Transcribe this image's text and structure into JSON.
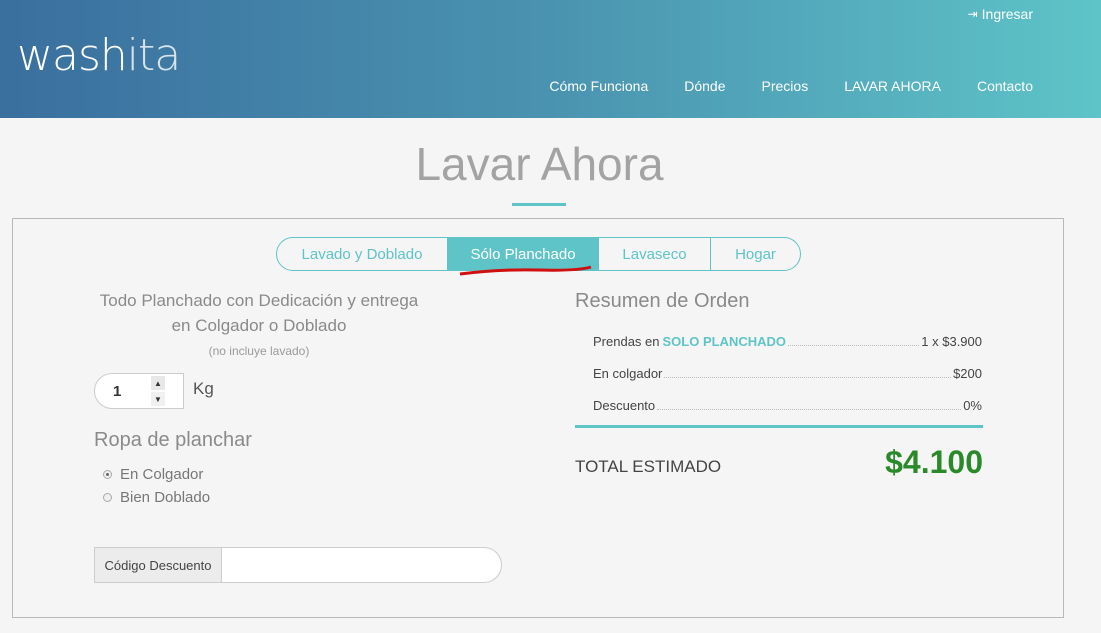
{
  "header": {
    "logo_main": "wash",
    "logo_tail": "ita",
    "login_icon": "sign-in-icon",
    "login_label": "Ingresar",
    "nav": [
      "Cómo Funciona",
      "Dónde",
      "Precios",
      "LAVAR AHORA",
      "Contacto"
    ]
  },
  "page": {
    "title": "Lavar Ahora"
  },
  "tabs": [
    "Lavado y Doblado",
    "Sólo Planchado",
    "Lavaseco",
    "Hogar"
  ],
  "tabs_active_index": 1,
  "service": {
    "description": "Todo Planchado con Dedicación y entrega en Colgador o Doblado",
    "note": "(no incluye lavado)",
    "quantity": "1",
    "unit": "Kg",
    "ropa_title": "Ropa de planchar",
    "options": [
      {
        "label": "En Colgador",
        "selected": true
      },
      {
        "label": "Bien Doblado",
        "selected": false
      }
    ],
    "discount_label": "Código Descuento",
    "discount_value": ""
  },
  "summary": {
    "title": "Resumen de Orden",
    "rows": [
      {
        "label": "Prendas en",
        "highlight": "SOLO PLANCHADO",
        "value": "1 x $3.900"
      },
      {
        "label": "En colgador",
        "highlight": "",
        "value": "$200"
      },
      {
        "label": "Descuento",
        "highlight": "",
        "value": "0%"
      }
    ],
    "total_label": "TOTAL ESTIMADO",
    "total_value": "$4.100"
  },
  "colors": {
    "accent": "#5ec4c8",
    "total": "#2a8a2a",
    "header_start": "#3a6f9e",
    "header_end": "#5ec4c8"
  }
}
